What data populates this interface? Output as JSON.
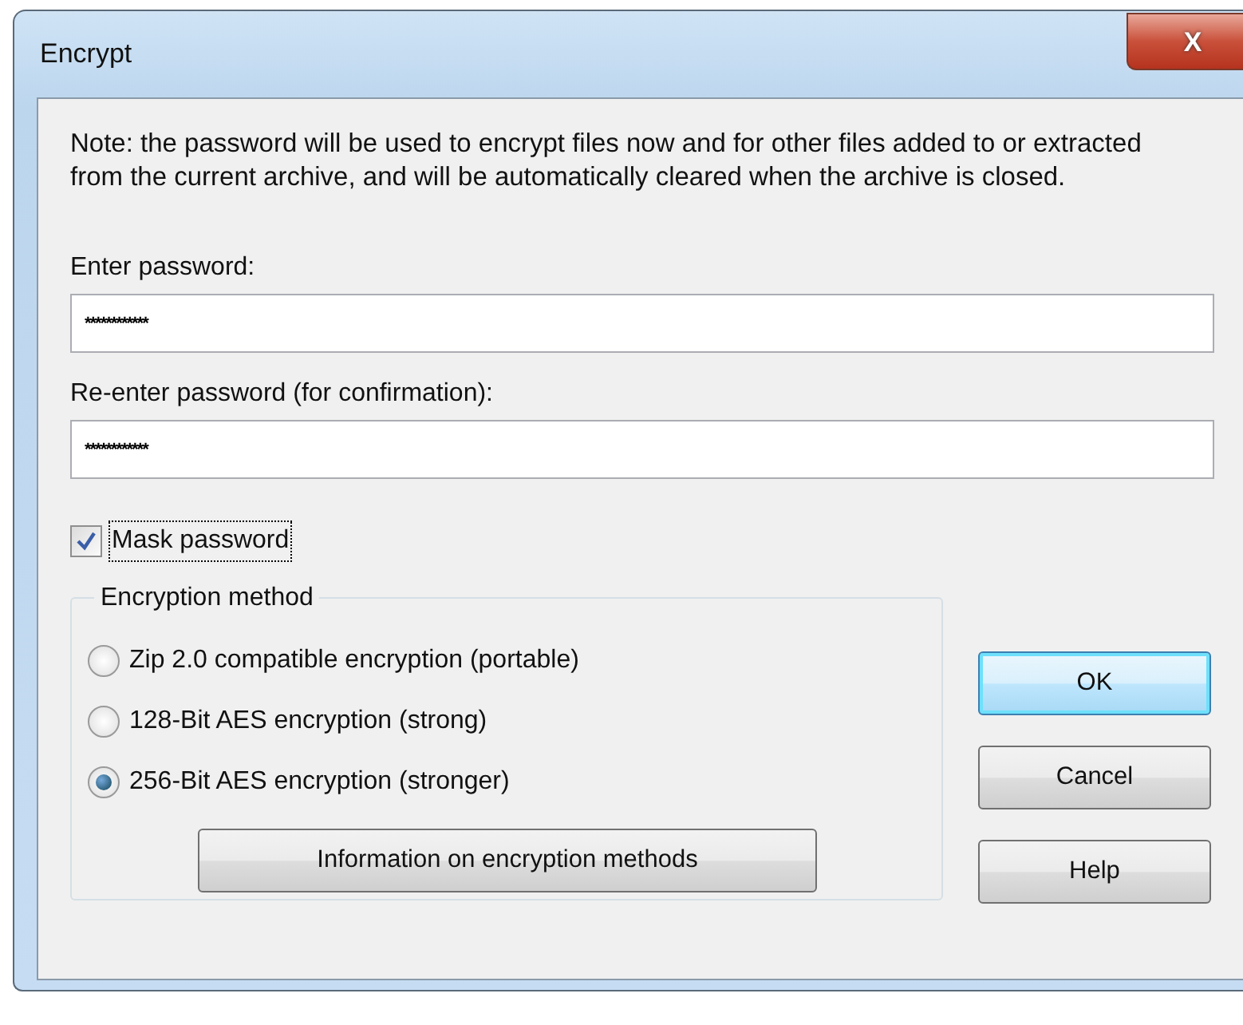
{
  "window": {
    "title": "Encrypt",
    "close": "X"
  },
  "note": "Note: the password will be used to encrypt files now and for other files added to or extracted from the current archive, and will be automatically cleared when the archive is closed.",
  "fields": [
    {
      "label": "Enter password:",
      "value": "************"
    },
    {
      "label": "Re-enter password (for confirmation):",
      "value": "************"
    }
  ],
  "mask": {
    "label": "Mask password",
    "checked": true
  },
  "method_group": {
    "title": "Encryption method",
    "options": [
      {
        "label": "Zip 2.0 compatible encryption (portable)",
        "selected": false
      },
      {
        "label": "128-Bit AES encryption (strong)",
        "selected": false
      },
      {
        "label": "256-Bit AES encryption (stronger)",
        "selected": true
      }
    ],
    "info_button": "Information on encryption methods"
  },
  "buttons": [
    {
      "label": "OK",
      "default": true
    },
    {
      "label": "Cancel",
      "default": false
    },
    {
      "label": "Help",
      "default": false
    }
  ]
}
